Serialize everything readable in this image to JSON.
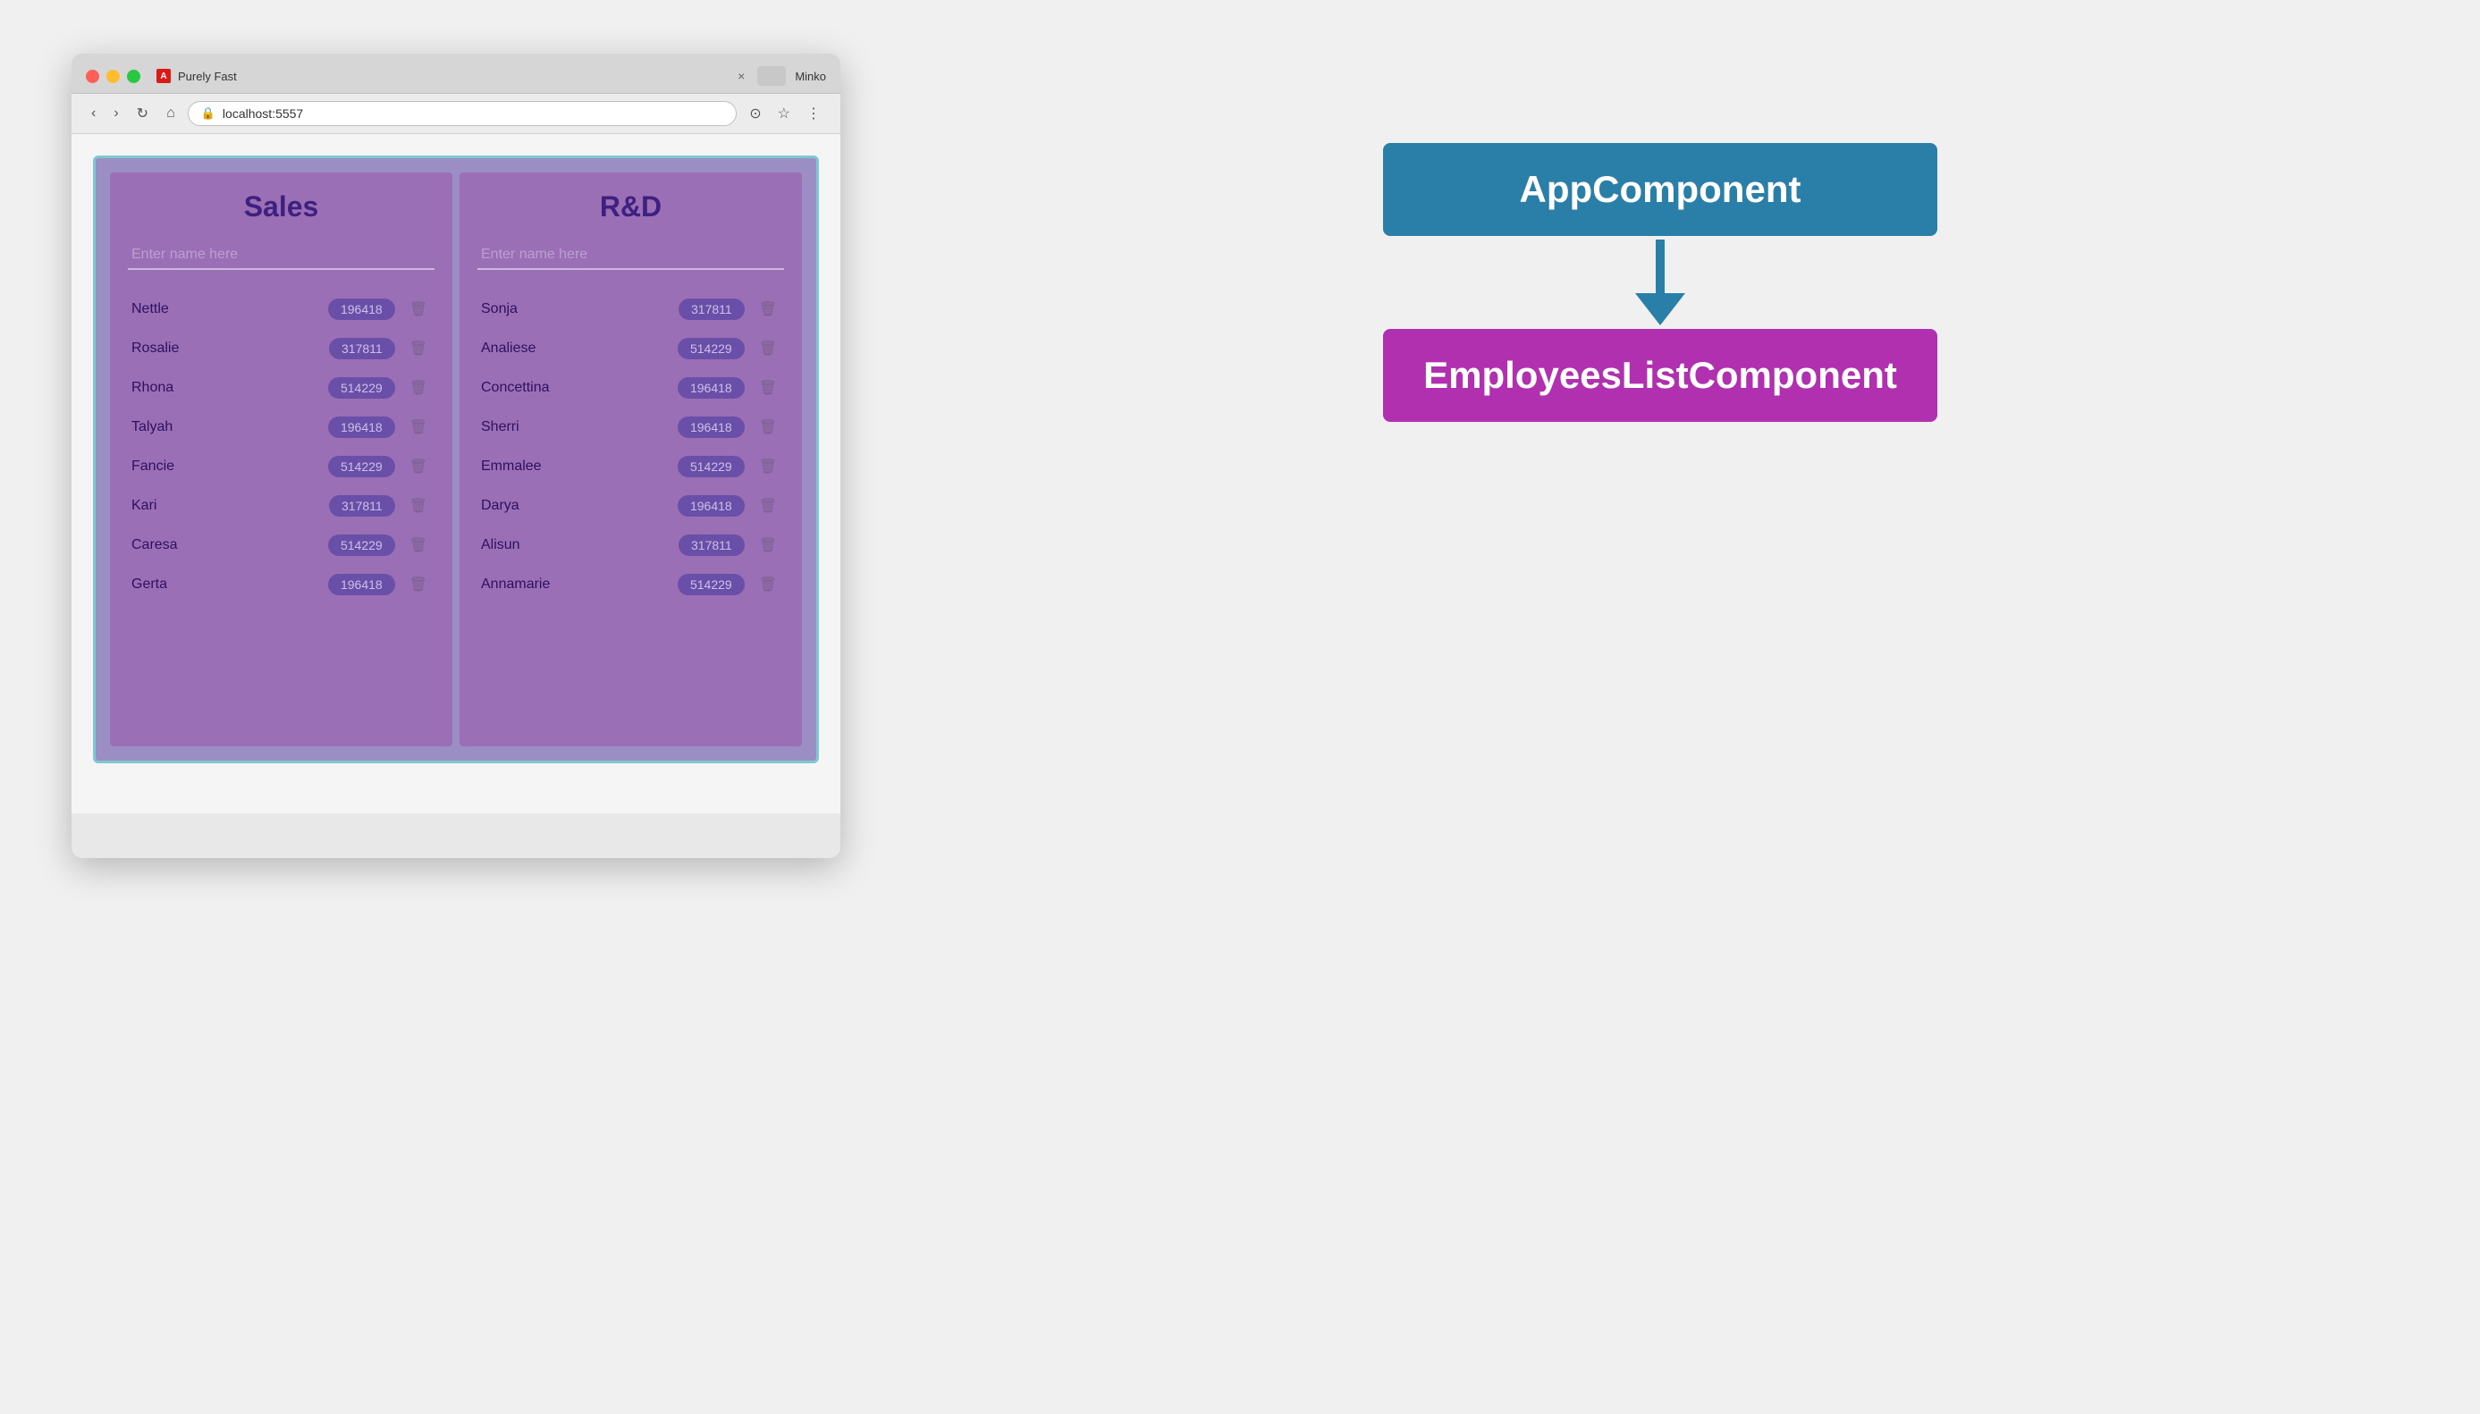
{
  "browser": {
    "tab_label": "Purely Fast",
    "tab_close": "×",
    "url": "localhost:5557",
    "user": "Minko"
  },
  "toolbar": {
    "back": "‹",
    "forward": "›",
    "refresh": "↻",
    "home": "⌂"
  },
  "sales": {
    "title": "Sales",
    "input_placeholder": "Enter name here",
    "employees": [
      {
        "name": "Nettle",
        "badge": "196418"
      },
      {
        "name": "Rosalie",
        "badge": "317811"
      },
      {
        "name": "Rhona",
        "badge": "514229"
      },
      {
        "name": "Talyah",
        "badge": "196418"
      },
      {
        "name": "Fancie",
        "badge": "514229"
      },
      {
        "name": "Kari",
        "badge": "317811"
      },
      {
        "name": "Caresa",
        "badge": "514229"
      },
      {
        "name": "Gerta",
        "badge": "196418"
      }
    ]
  },
  "rnd": {
    "title": "R&D",
    "input_placeholder": "Enter name here",
    "employees": [
      {
        "name": "Sonja",
        "badge": "317811"
      },
      {
        "name": "Analiese",
        "badge": "514229"
      },
      {
        "name": "Concettina",
        "badge": "196418"
      },
      {
        "name": "Sherri",
        "badge": "196418"
      },
      {
        "name": "Emmalee",
        "badge": "514229"
      },
      {
        "name": "Darya",
        "badge": "196418"
      },
      {
        "name": "Alisun",
        "badge": "317811"
      },
      {
        "name": "Annamarie",
        "badge": "514229"
      }
    ]
  },
  "diagram": {
    "app_component": "AppComponent",
    "employees_component": "EmployeesListComponent"
  }
}
